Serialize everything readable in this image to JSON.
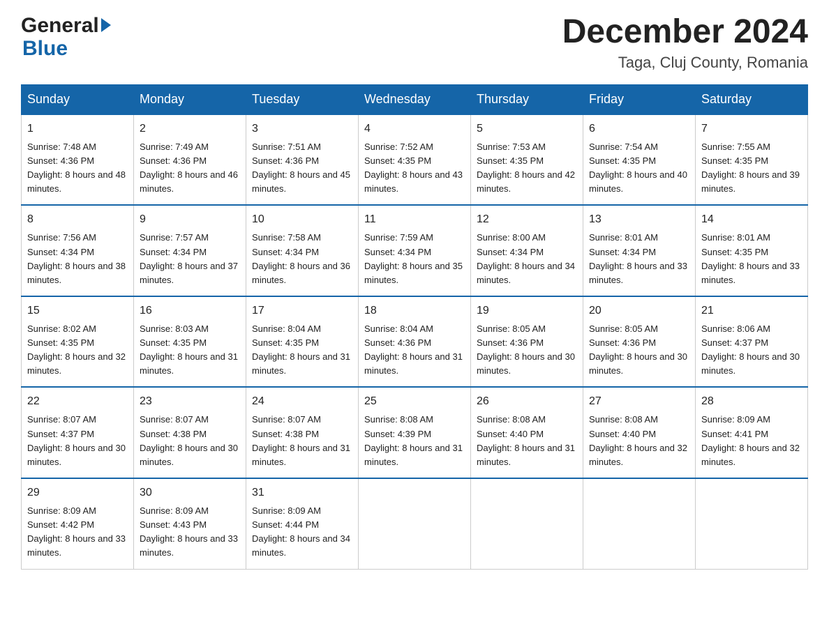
{
  "logo": {
    "general": "General",
    "blue": "Blue"
  },
  "header": {
    "month": "December 2024",
    "location": "Taga, Cluj County, Romania"
  },
  "weekdays": [
    "Sunday",
    "Monday",
    "Tuesday",
    "Wednesday",
    "Thursday",
    "Friday",
    "Saturday"
  ],
  "weeks": [
    [
      {
        "day": 1,
        "sunrise": "7:48 AM",
        "sunset": "4:36 PM",
        "daylight": "8 hours and 48 minutes."
      },
      {
        "day": 2,
        "sunrise": "7:49 AM",
        "sunset": "4:36 PM",
        "daylight": "8 hours and 46 minutes."
      },
      {
        "day": 3,
        "sunrise": "7:51 AM",
        "sunset": "4:36 PM",
        "daylight": "8 hours and 45 minutes."
      },
      {
        "day": 4,
        "sunrise": "7:52 AM",
        "sunset": "4:35 PM",
        "daylight": "8 hours and 43 minutes."
      },
      {
        "day": 5,
        "sunrise": "7:53 AM",
        "sunset": "4:35 PM",
        "daylight": "8 hours and 42 minutes."
      },
      {
        "day": 6,
        "sunrise": "7:54 AM",
        "sunset": "4:35 PM",
        "daylight": "8 hours and 40 minutes."
      },
      {
        "day": 7,
        "sunrise": "7:55 AM",
        "sunset": "4:35 PM",
        "daylight": "8 hours and 39 minutes."
      }
    ],
    [
      {
        "day": 8,
        "sunrise": "7:56 AM",
        "sunset": "4:34 PM",
        "daylight": "8 hours and 38 minutes."
      },
      {
        "day": 9,
        "sunrise": "7:57 AM",
        "sunset": "4:34 PM",
        "daylight": "8 hours and 37 minutes."
      },
      {
        "day": 10,
        "sunrise": "7:58 AM",
        "sunset": "4:34 PM",
        "daylight": "8 hours and 36 minutes."
      },
      {
        "day": 11,
        "sunrise": "7:59 AM",
        "sunset": "4:34 PM",
        "daylight": "8 hours and 35 minutes."
      },
      {
        "day": 12,
        "sunrise": "8:00 AM",
        "sunset": "4:34 PM",
        "daylight": "8 hours and 34 minutes."
      },
      {
        "day": 13,
        "sunrise": "8:01 AM",
        "sunset": "4:34 PM",
        "daylight": "8 hours and 33 minutes."
      },
      {
        "day": 14,
        "sunrise": "8:01 AM",
        "sunset": "4:35 PM",
        "daylight": "8 hours and 33 minutes."
      }
    ],
    [
      {
        "day": 15,
        "sunrise": "8:02 AM",
        "sunset": "4:35 PM",
        "daylight": "8 hours and 32 minutes."
      },
      {
        "day": 16,
        "sunrise": "8:03 AM",
        "sunset": "4:35 PM",
        "daylight": "8 hours and 31 minutes."
      },
      {
        "day": 17,
        "sunrise": "8:04 AM",
        "sunset": "4:35 PM",
        "daylight": "8 hours and 31 minutes."
      },
      {
        "day": 18,
        "sunrise": "8:04 AM",
        "sunset": "4:36 PM",
        "daylight": "8 hours and 31 minutes."
      },
      {
        "day": 19,
        "sunrise": "8:05 AM",
        "sunset": "4:36 PM",
        "daylight": "8 hours and 30 minutes."
      },
      {
        "day": 20,
        "sunrise": "8:05 AM",
        "sunset": "4:36 PM",
        "daylight": "8 hours and 30 minutes."
      },
      {
        "day": 21,
        "sunrise": "8:06 AM",
        "sunset": "4:37 PM",
        "daylight": "8 hours and 30 minutes."
      }
    ],
    [
      {
        "day": 22,
        "sunrise": "8:07 AM",
        "sunset": "4:37 PM",
        "daylight": "8 hours and 30 minutes."
      },
      {
        "day": 23,
        "sunrise": "8:07 AM",
        "sunset": "4:38 PM",
        "daylight": "8 hours and 30 minutes."
      },
      {
        "day": 24,
        "sunrise": "8:07 AM",
        "sunset": "4:38 PM",
        "daylight": "8 hours and 31 minutes."
      },
      {
        "day": 25,
        "sunrise": "8:08 AM",
        "sunset": "4:39 PM",
        "daylight": "8 hours and 31 minutes."
      },
      {
        "day": 26,
        "sunrise": "8:08 AM",
        "sunset": "4:40 PM",
        "daylight": "8 hours and 31 minutes."
      },
      {
        "day": 27,
        "sunrise": "8:08 AM",
        "sunset": "4:40 PM",
        "daylight": "8 hours and 32 minutes."
      },
      {
        "day": 28,
        "sunrise": "8:09 AM",
        "sunset": "4:41 PM",
        "daylight": "8 hours and 32 minutes."
      }
    ],
    [
      {
        "day": 29,
        "sunrise": "8:09 AM",
        "sunset": "4:42 PM",
        "daylight": "8 hours and 33 minutes."
      },
      {
        "day": 30,
        "sunrise": "8:09 AM",
        "sunset": "4:43 PM",
        "daylight": "8 hours and 33 minutes."
      },
      {
        "day": 31,
        "sunrise": "8:09 AM",
        "sunset": "4:44 PM",
        "daylight": "8 hours and 34 minutes."
      },
      null,
      null,
      null,
      null
    ]
  ]
}
